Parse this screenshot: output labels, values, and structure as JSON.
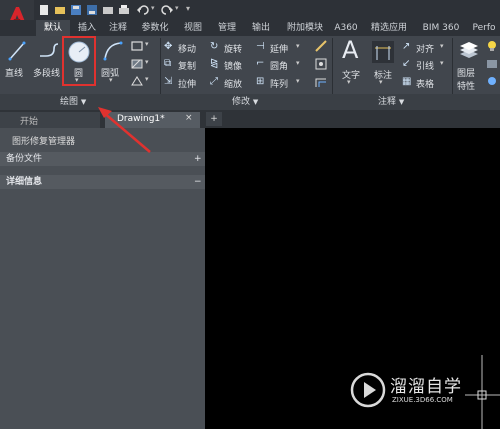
{
  "tabs": [
    "默认",
    "插入",
    "注释",
    "参数化",
    "视图",
    "管理",
    "输出",
    "附加模块",
    "A360",
    "精选应用",
    "BIM 360",
    "Perfo"
  ],
  "draw_panel": {
    "line": "直线",
    "polyline": "多段线",
    "circle": "圆",
    "arc": "圆弧",
    "title": "绘图"
  },
  "modify_panel": {
    "move": "移动",
    "rotate": "旋转",
    "trim": "延伸",
    "copy": "复制",
    "mirror": "镜像",
    "fillet": "圆角",
    "stretch": "拉伸",
    "scale": "缩放",
    "array": "阵列",
    "title": "修改"
  },
  "annotation_panel": {
    "text": "文字",
    "dimension": "标注",
    "align": "对齐",
    "leader": "引线",
    "table": "表格",
    "title": "注释"
  },
  "layers_panel": {
    "layer_props_1": "图层",
    "layer_props_2": "特性"
  },
  "doc_tabs": {
    "start": "开始",
    "drawing": "Drawing1*",
    "add": "+",
    "close": "×"
  },
  "left_panel": {
    "title": "图形修复管理器",
    "backup": "备份文件",
    "backup_toggle": "+",
    "details": "详细信息",
    "details_toggle": "−"
  },
  "watermark": {
    "brand": "溜溜自学",
    "url": "ZIXUE.3D66.COM"
  },
  "colors": {
    "highlight_box": "#e0322f",
    "arrow": "#e0322f"
  }
}
